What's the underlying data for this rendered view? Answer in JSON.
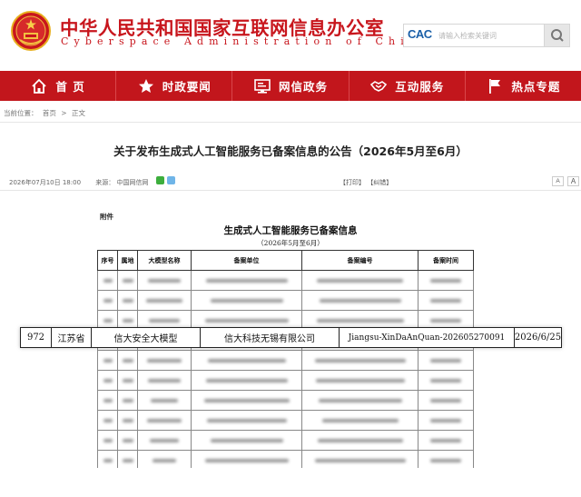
{
  "header": {
    "title_cn": "中华人民共和国国家互联网信息办公室",
    "title_en": "Cyberspace  Administration  of  China",
    "search_placeholder": "请输入检索关键词",
    "cac_logo": "CAC"
  },
  "nav": {
    "items": [
      {
        "label": "首 页",
        "icon": "home-icon"
      },
      {
        "label": "时政要闻",
        "icon": "star-icon"
      },
      {
        "label": "网信政务",
        "icon": "monitor-icon"
      },
      {
        "label": "互动服务",
        "icon": "handshake-icon"
      },
      {
        "label": "热点专题",
        "icon": "flag-icon"
      }
    ]
  },
  "breadcrumb": {
    "prefix": "当前位置：",
    "home": "首页",
    "separator": ">",
    "current": "正文"
  },
  "article": {
    "title": "关于发布生成式人工智能服务已备案信息的公告（2026年5月至6月）",
    "date": "2026年07月10日  18:00",
    "source": "来源：  中国网信网",
    "print": "【打印】",
    "correction": "【纠错】",
    "font_smaller": "A",
    "font_larger": "A",
    "attachment_label": "附件",
    "doc_title": "生成式人工智能服务已备案信息",
    "doc_subtitle": "（2026年5月至6月）"
  },
  "table": {
    "headers": [
      "序号",
      "属地",
      "大模型名称",
      "备案单位",
      "备案编号",
      "备案时间"
    ]
  },
  "highlighted_row": {
    "index": "972",
    "region": "江苏省",
    "model": "信大安全大模型",
    "company": "信大科技无锡有限公司",
    "record_id": "Jiangsu-XinDaAnQuan-202605270091",
    "date": "2026/6/25"
  },
  "colors": {
    "brand_red": "#c8161d",
    "nav_red": "#c2161c"
  }
}
